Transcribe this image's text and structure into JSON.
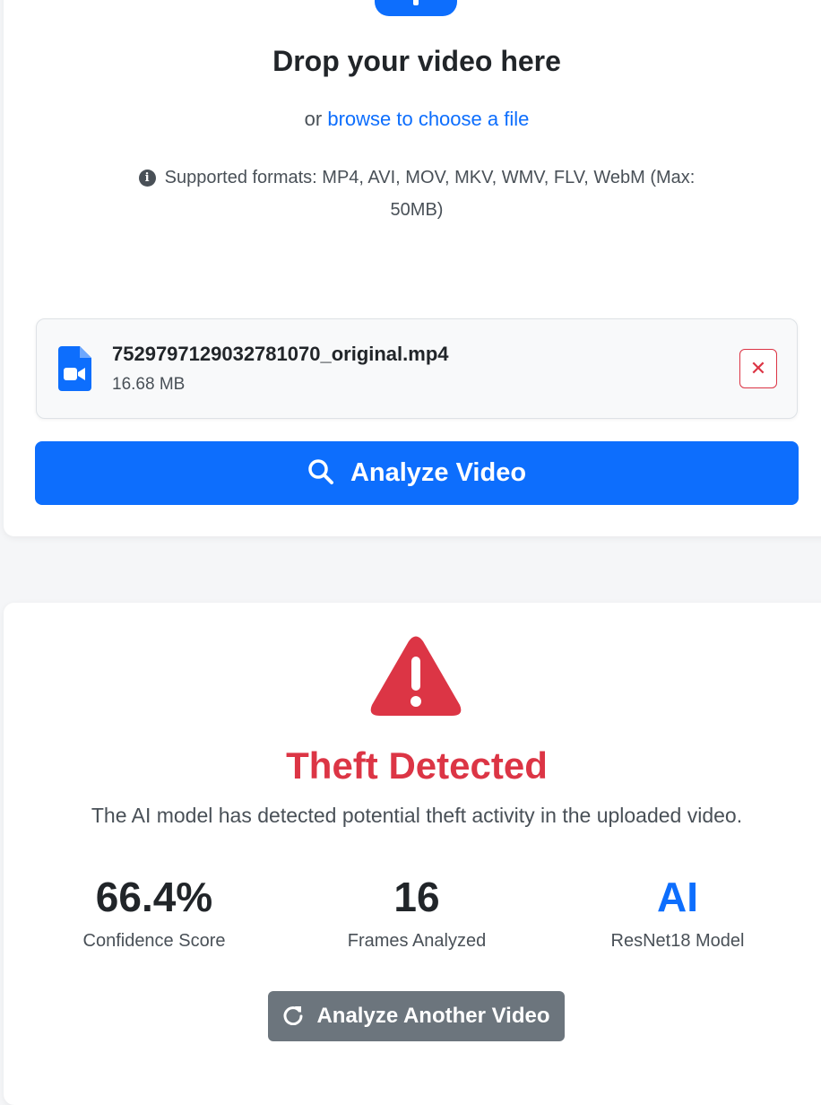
{
  "upload": {
    "title": "Drop your video here",
    "browse_prefix": "or",
    "browse_link": "browse to choose a file",
    "formats_text": "Supported formats: MP4, AVI, MOV, MKV, WMV, FLV, WebM (Max: 50MB)",
    "icons": {
      "upload": "upload-icon",
      "info": "info-circle-icon"
    }
  },
  "file": {
    "name": "7529797129032781070_original.mp4",
    "size": "16.68 MB",
    "remove_label": "✕",
    "icon": "file-video-icon"
  },
  "actions": {
    "analyze_label": "Analyze Video",
    "analyze_another_label": "Analyze Another Video"
  },
  "result": {
    "status_title": "Theft Detected",
    "description": "The AI model has detected potential theft activity in the uploaded video.",
    "icon": "warning-triangle-icon",
    "stats": [
      {
        "value": "66.4%",
        "label": "Confidence Score"
      },
      {
        "value": "16",
        "label": "Frames Analyzed"
      },
      {
        "value": "AI",
        "label": "ResNet18 Model"
      }
    ]
  },
  "colors": {
    "primary": "#0d6efd",
    "danger": "#dc3545",
    "secondary": "#6c757d",
    "text": "#212529",
    "muted": "#495057"
  }
}
